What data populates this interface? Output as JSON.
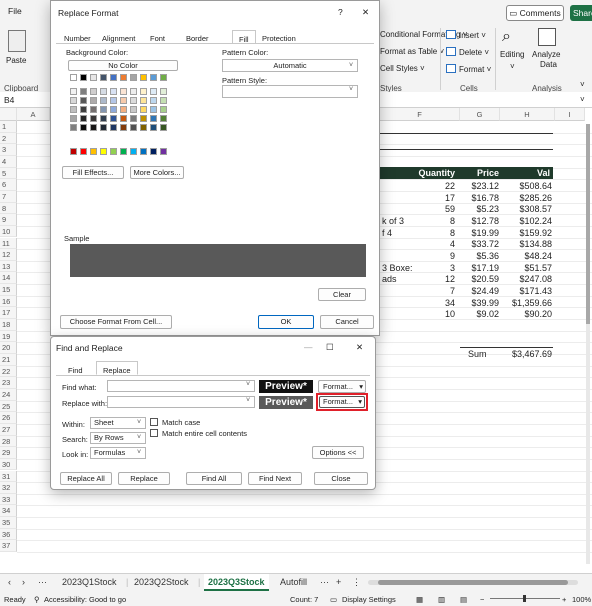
{
  "ribbon": {
    "tabs": [
      "File"
    ],
    "comments_label": "Comments",
    "share_label": "Share",
    "cond_format_label": "Conditional Formatting",
    "format_table_label": "Format as Table",
    "cell_styles_label": "Cell Styles",
    "styles_group": "Styles",
    "insert_label": "Insert",
    "delete_label": "Delete",
    "format_label": "Format",
    "cells_group": "Cells",
    "editing_label": "Editing",
    "analyze_label": "Analyze",
    "data_label": "Data",
    "analysis_group": "Analysis",
    "paste_label": "Paste",
    "clipboard_group": "Clipboard"
  },
  "formula_bar": {
    "name_box": "B4"
  },
  "grid": {
    "columns": [
      "A",
      "F",
      "G",
      "H",
      "I"
    ],
    "rows": [
      "1",
      "2",
      "3",
      "4",
      "5",
      "6",
      "7",
      "8",
      "9",
      "10",
      "11",
      "12",
      "13",
      "14",
      "15",
      "16",
      "17",
      "18",
      "19",
      "20",
      "21",
      "22",
      "23",
      "24",
      "25",
      "26",
      "27",
      "28",
      "29",
      "30",
      "31",
      "32",
      "33",
      "34",
      "35",
      "36",
      "37"
    ],
    "header": {
      "quantity": "Quantity",
      "price": "Price",
      "value": "Val"
    },
    "data": [
      {
        "label": "",
        "qty": "22",
        "price": "$23.12",
        "value": "$508.64"
      },
      {
        "label": "",
        "qty": "17",
        "price": "$16.78",
        "value": "$285.26"
      },
      {
        "label": "",
        "qty": "59",
        "price": "$5.23",
        "value": "$308.57"
      },
      {
        "label": "k of 3",
        "qty": "8",
        "price": "$12.78",
        "value": "$102.24"
      },
      {
        "label": "f 4",
        "qty": "8",
        "price": "$19.99",
        "value": "$159.92"
      },
      {
        "label": "",
        "qty": "4",
        "price": "$33.72",
        "value": "$134.88"
      },
      {
        "label": "",
        "qty": "9",
        "price": "$5.36",
        "value": "$48.24"
      },
      {
        "label": "3 Boxe:",
        "qty": "3",
        "price": "$17.19",
        "value": "$51.57"
      },
      {
        "label": "ads",
        "qty": "12",
        "price": "$20.59",
        "value": "$247.08"
      },
      {
        "label": "",
        "qty": "7",
        "price": "$24.49",
        "value": "$171.43"
      },
      {
        "label": "",
        "qty": "34",
        "price": "$39.99",
        "value": "$1,359.66"
      },
      {
        "label": "",
        "qty": "10",
        "price": "$9.02",
        "value": "$90.20"
      }
    ],
    "sum_label": "Sum",
    "sum_value": "$3,467.69"
  },
  "sheets": {
    "tabs": [
      "2023Q1Stock",
      "2023Q2Stock",
      "2023Q3Stock",
      "Autofill"
    ],
    "active": "2023Q3Stock",
    "more": "···",
    "add": "+"
  },
  "status": {
    "ready": "Ready",
    "accessibility": "Accessibility: Good to go",
    "count": "Count: 7",
    "display_settings": "Display Settings",
    "zoom": "100%"
  },
  "replace_format": {
    "title": "Replace Format",
    "help": "?",
    "close": "✕",
    "tabs": [
      "Number",
      "Alignment",
      "Font",
      "Border",
      "Fill",
      "Protection"
    ],
    "active_tab": "Fill",
    "bg_color_label": "Background Color:",
    "no_color": "No Color",
    "pattern_color_label": "Pattern Color:",
    "pattern_color_value": "Automatic",
    "pattern_style_label": "Pattern Style:",
    "fill_effects": "Fill Effects...",
    "more_colors": "More Colors...",
    "sample_label": "Sample",
    "sample_color": "#595959",
    "clear": "Clear",
    "choose_format": "Choose Format From Cell...",
    "ok": "OK",
    "cancel": "Cancel"
  },
  "find_replace": {
    "title": "Find and Replace",
    "minimize": "—",
    "maximize": "☐",
    "close": "✕",
    "tabs": [
      "Find",
      "Replace"
    ],
    "active_tab": "Replace",
    "find_what_label": "Find what:",
    "replace_with_label": "Replace with:",
    "preview1": "Preview*",
    "preview2": "Preview*",
    "format1": "Format...",
    "format2": "Format...",
    "within_label": "Within:",
    "within_value": "Sheet",
    "search_label": "Search:",
    "search_value": "By Rows",
    "lookin_label": "Look in:",
    "lookin_value": "Formulas",
    "match_case": "Match case",
    "match_entire": "Match entire cell contents",
    "options": "Options <<",
    "replace_all": "Replace All",
    "replace": "Replace",
    "find_all": "Find All",
    "find_next": "Find Next",
    "close_btn": "Close",
    "highlight_color": "#e0202a"
  }
}
